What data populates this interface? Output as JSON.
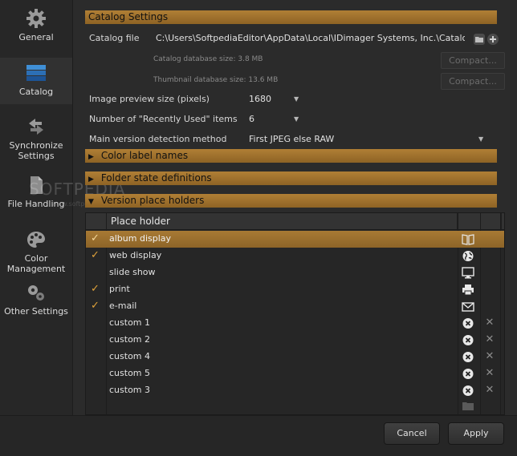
{
  "sidebar": {
    "items": [
      {
        "label": "General",
        "icon": "gear-icon"
      },
      {
        "label": "Catalog",
        "icon": "catalog-icon"
      },
      {
        "label": "Synchronize Settings",
        "icon": "sync-arrows-icon"
      },
      {
        "label": "File Handling",
        "icon": "file-icon"
      },
      {
        "label": "Color Management",
        "icon": "palette-icon"
      },
      {
        "label": "Other Settings",
        "icon": "gears-icon"
      }
    ],
    "sync_line1": "Synchronize",
    "sync_line2": "Settings",
    "color_line1": "Color",
    "color_line2": "Management"
  },
  "catalog": {
    "header": "Catalog Settings",
    "file_label": "Catalog file",
    "file_path": "C:\\Users\\SoftpediaEditor\\AppData\\Local\\IDimager Systems, Inc.\\Catalog\\id",
    "db_size_label": "Catalog database size: 3.8 MB",
    "thumb_size_label": "Thumbnail database size: 13.6 MB",
    "compact_label": "Compact...",
    "preview_label": "Image preview size (pixels)",
    "preview_value": "1680",
    "recent_label": "Number of \"Recently Used\" items",
    "recent_value": "6",
    "version_label": "Main version detection method",
    "version_value": "First JPEG else RAW"
  },
  "sections": {
    "color_labels": "Color label names",
    "folder_state": "Folder state definitions",
    "version_holders": "Version place holders"
  },
  "table": {
    "column_header": "Place holder",
    "rows": [
      {
        "name": "album display",
        "checked": true,
        "icon": "book-icon",
        "deletable": false
      },
      {
        "name": "web display",
        "checked": true,
        "icon": "globe-icon",
        "deletable": false
      },
      {
        "name": "slide show",
        "checked": false,
        "icon": "monitor-icon",
        "deletable": false
      },
      {
        "name": "print",
        "checked": true,
        "icon": "printer-icon",
        "deletable": false
      },
      {
        "name": "e-mail",
        "checked": true,
        "icon": "envelope-icon",
        "deletable": false
      },
      {
        "name": "custom 1",
        "checked": false,
        "icon": "close-circle-icon",
        "deletable": true
      },
      {
        "name": "custom 2",
        "checked": false,
        "icon": "close-circle-icon",
        "deletable": true
      },
      {
        "name": "custom 4",
        "checked": false,
        "icon": "close-circle-icon",
        "deletable": true
      },
      {
        "name": "custom 5",
        "checked": false,
        "icon": "close-circle-icon",
        "deletable": true
      },
      {
        "name": "custom 3",
        "checked": false,
        "icon": "close-circle-icon",
        "deletable": true
      }
    ],
    "check_glyph": "✓",
    "delete_glyph": "✕"
  },
  "footer": {
    "cancel_label": "Cancel",
    "apply_label": "Apply"
  },
  "watermark": {
    "text": "SOFTPEDIA",
    "sub": "www.softpedia.com"
  },
  "colors": {
    "accent": "#a87a34",
    "check": "#e0a23a",
    "background": "#2b2b2b"
  }
}
